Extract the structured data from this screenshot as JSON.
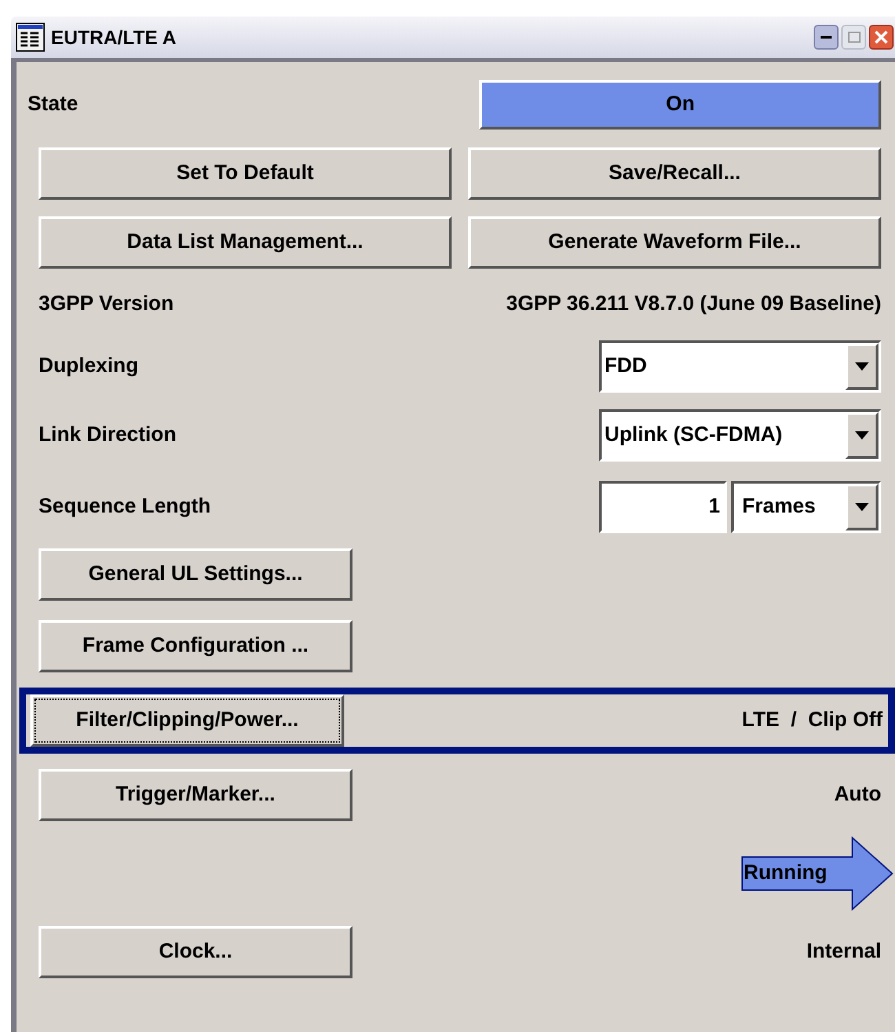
{
  "window": {
    "title": "EUTRA/LTE A"
  },
  "rows": [
    {
      "kind": "state",
      "label": "State",
      "value": "On",
      "on": true
    },
    {
      "kind": "buttons",
      "buttons": [
        "Set To Default",
        "Save/Recall..."
      ]
    },
    {
      "kind": "buttons",
      "buttons": [
        "Data List Management...",
        "Generate Waveform File..."
      ]
    },
    {
      "kind": "info",
      "label": "3GPP Version",
      "value": "3GPP 36.211 V8.7.0 (June 09 Baseline)"
    },
    {
      "kind": "select",
      "label": "Duplexing",
      "value": "FDD"
    },
    {
      "kind": "select",
      "label": "Link Direction",
      "value": "Uplink (SC-FDMA)"
    },
    {
      "kind": "number",
      "label": "Sequence Length",
      "value": "1",
      "unit": "Frames"
    },
    {
      "kind": "button",
      "button": "General UL Settings...",
      "focused": false
    },
    {
      "kind": "button",
      "button": "Frame Configuration ...",
      "focused": false
    },
    {
      "kind": "button",
      "button": "Filter/Clipping/Power...",
      "value": "LTE  /  Clip Off",
      "focused": true
    },
    {
      "kind": "button",
      "button": "Trigger/Marker...",
      "value": "Auto",
      "focused": false
    },
    {
      "kind": "running",
      "value": "Running"
    },
    {
      "kind": "button",
      "button": "Clock...",
      "value": "Internal",
      "focused": false
    }
  ]
}
